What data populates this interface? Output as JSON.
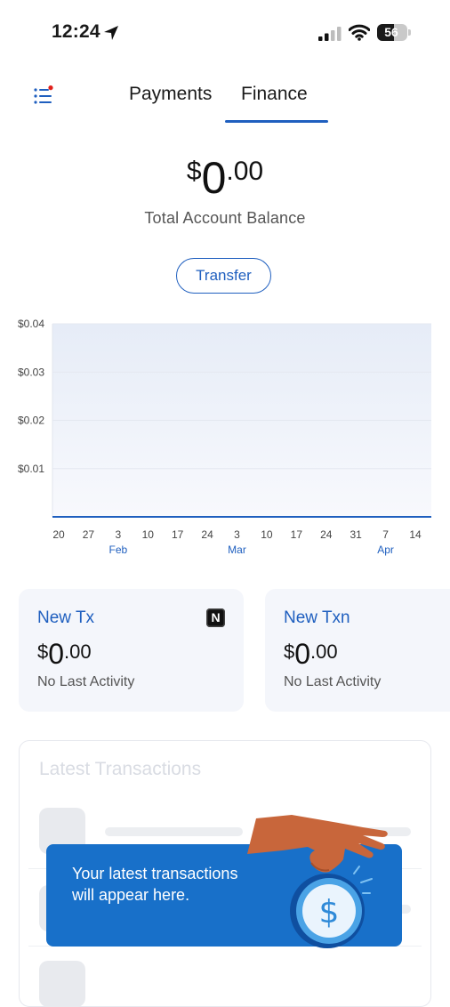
{
  "status_bar": {
    "time": "12:24",
    "battery": "56"
  },
  "header": {
    "tabs": [
      {
        "label": "Payments",
        "active": false
      },
      {
        "label": "Finance",
        "active": true
      }
    ],
    "menu_notification_color": "#e0201b"
  },
  "balance": {
    "currency": "$",
    "whole": "0",
    "cents": ".00",
    "label": "Total Account Balance"
  },
  "transfer_button": {
    "label": "Transfer"
  },
  "chart_data": {
    "type": "area",
    "y_ticks": [
      "$0.04",
      "$0.03",
      "$0.02",
      "$0.01"
    ],
    "ylim": [
      0,
      0.04
    ],
    "x_ticks": [
      "20",
      "27",
      "3",
      "10",
      "17",
      "24",
      "3",
      "10",
      "17",
      "24",
      "31",
      "7",
      "14"
    ],
    "month_labels": [
      {
        "label": "Feb",
        "tick_index": 2
      },
      {
        "label": "Mar",
        "tick_index": 6
      },
      {
        "label": "Apr",
        "tick_index": 11
      }
    ],
    "values": [
      0,
      0,
      0,
      0,
      0,
      0,
      0,
      0,
      0,
      0,
      0,
      0,
      0
    ],
    "line_color": "#1f5fbf",
    "fill_color": "#e9eef8"
  },
  "cards": [
    {
      "title": "New Tx",
      "currency": "$",
      "whole": "0",
      "cents": ".00",
      "subtitle": "No Last Activity",
      "badge": "N"
    },
    {
      "title": "New Txn",
      "currency": "$",
      "whole": "0",
      "cents": ".00",
      "subtitle": "No Last Activity"
    }
  ],
  "latest_transactions": {
    "title": "Latest Transactions"
  },
  "toast": {
    "message": "Your latest transactions will appear here."
  }
}
